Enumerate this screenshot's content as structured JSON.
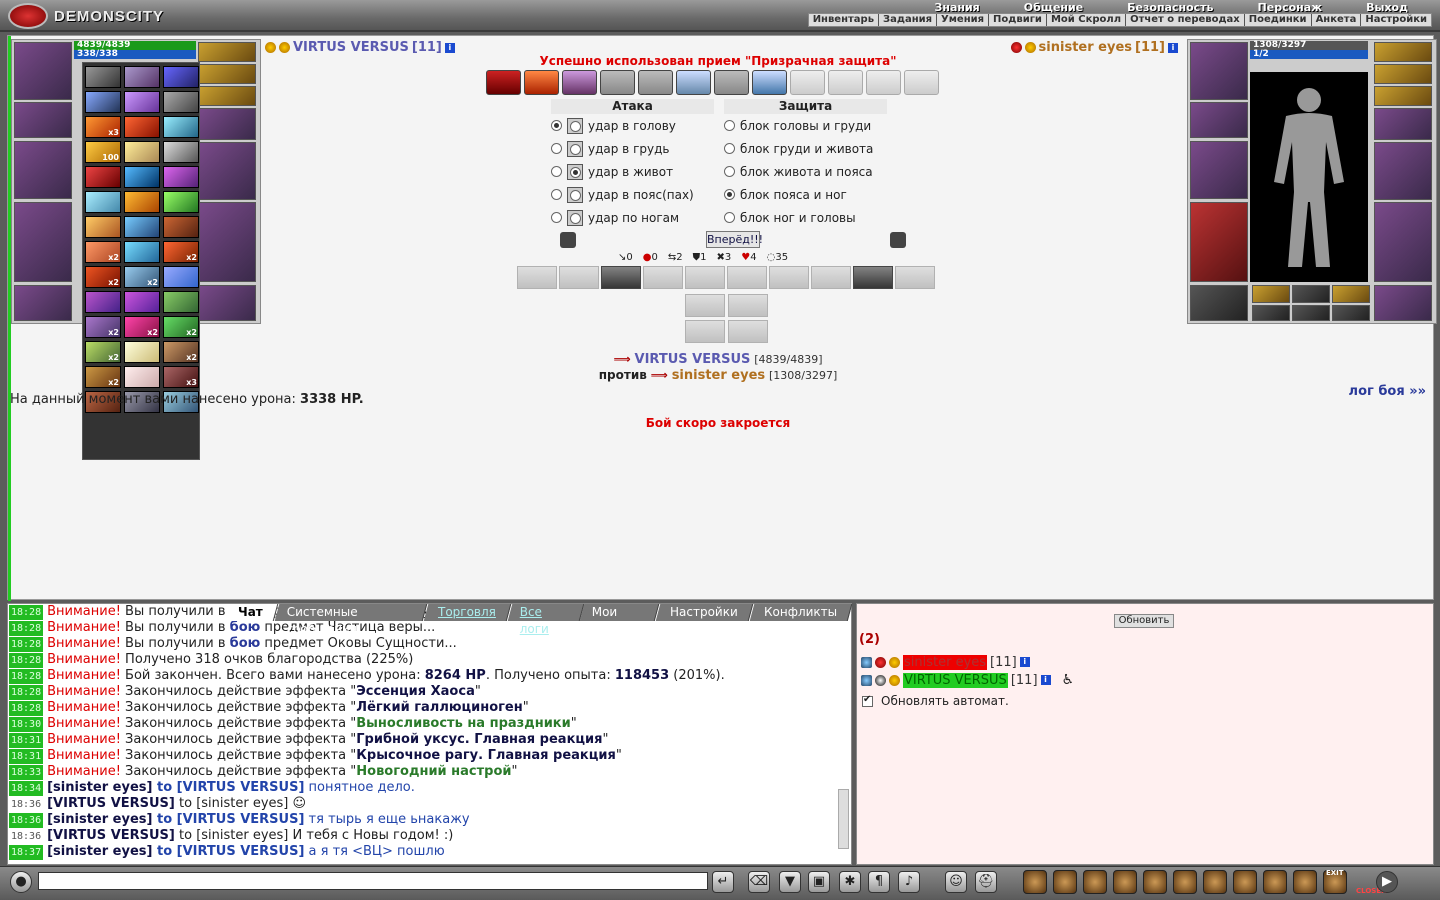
{
  "brand": {
    "name": "DEMONSCITY"
  },
  "nav": {
    "main": [
      "Знания",
      "Общение",
      "Безопасность",
      "Персонаж",
      "Выход"
    ],
    "sub": [
      "Инвентарь",
      "Задания",
      "Умения",
      "Подвиги",
      "Мой Скролл",
      "Отчет о переводах",
      "Поединки",
      "Анкета",
      "Настройки"
    ]
  },
  "player1": {
    "name": "VIRTUS VERSUS",
    "level": "[11]",
    "hp": "4839/4839",
    "mana": "338/338",
    "hp_full": "[4839/4839]"
  },
  "player2": {
    "name": "sinister eyes",
    "level": "[11]",
    "hp": "1308/3297",
    "mana": "1/2",
    "hp_full": "[1308/3297]"
  },
  "battle": {
    "status": "Успешно использован прием \"Призрачная защита\"",
    "attack_header": "Атака",
    "defense_header": "Защита",
    "attack_options": [
      "удар в голову",
      "удар в грудь",
      "удар в живот",
      "удар в пояс(пах)",
      "удар по ногам"
    ],
    "defense_options": [
      "блок головы и груди",
      "блок груди и живота",
      "блок живота и пояса",
      "блок пояса и ног",
      "блок ног и головы"
    ],
    "go_label": "Вперёд!!!",
    "counters": [
      "0",
      "0",
      "2",
      "1",
      "3",
      "4",
      "35"
    ],
    "versus_word": "против",
    "damage_prefix": "На данный момент вами нанесено урона:",
    "damage_value": "3338 HP.",
    "log_link": "лог боя »»",
    "closing_note": "Бой скоро закроется",
    "effect_badges": [
      "x3",
      "100",
      "x2",
      "x2",
      "x2",
      "x2",
      "x2",
      "x2",
      "x2",
      "x2",
      "x2",
      "x2",
      "x3"
    ]
  },
  "chat": {
    "tabs": [
      "Чат",
      "Системные сообщения",
      "Торговля",
      "Все логи",
      "Мои логи",
      "Настройки",
      "Конфликты"
    ],
    "lines": [
      {
        "t": "18:28",
        "warn": "Внимание!",
        "pre": " Вы получили в ",
        "link": "бою",
        "post": " предмет Сущность безумия..."
      },
      {
        "t": "18:28",
        "warn": "Внимание!",
        "pre": " Вы получили в ",
        "link": "бою",
        "post": " предмет Частица веры..."
      },
      {
        "t": "18:28",
        "warn": "Внимание!",
        "pre": " Вы получили в ",
        "link": "бою",
        "post": " предмет Оковы Сущности..."
      },
      {
        "t": "18:28",
        "warn": "Внимание!",
        "pre": " Получено 318 очков благородства (225%)",
        "link": "",
        "post": ""
      },
      {
        "t": "18:28",
        "warn": "Внимание!",
        "pre": " Бой закончен. Всего вами нанесено урона: ",
        "bold": "8264 HP",
        "post": ". Получено опыта: ",
        "bold2": "118453",
        "post2": " (201%)."
      },
      {
        "t": "18:28",
        "warn": "Внимание!",
        "pre": " Закончилось действие эффекта \"",
        "bold": "Эссенция Хаоса",
        "post": "\""
      },
      {
        "t": "18:28",
        "warn": "Внимание!",
        "pre": " Закончилось действие эффекта \"",
        "bold": "Лёгкий галлюциноген",
        "post": "\""
      },
      {
        "t": "18:30",
        "warn": "Внимание!",
        "pre": " Закончилось действие эффекта \"",
        "green": "Выносливость на праздники",
        "post": "\""
      },
      {
        "t": "18:31",
        "warn": "Внимание!",
        "pre": " Закончилось действие эффекта \"",
        "bold": "Грибной уксус. Главная реакция",
        "post": "\""
      },
      {
        "t": "18:31",
        "warn": "Внимание!",
        "pre": " Закончилось действие эффекта \"",
        "bold": "Крысочное рагу. Главная реакция",
        "post": "\""
      },
      {
        "t": "18:33",
        "warn": "Внимание!",
        "pre": " Закончилось действие эффекта \"",
        "green": "Новогодний настрой",
        "post": "\""
      }
    ],
    "msgs": [
      {
        "t": "18:34",
        "plain": false,
        "from": "[sinister eyes]",
        "to": " to [VIRTUS VERSUS]",
        "text": " понятное дело."
      },
      {
        "t": "18:36",
        "plain": true,
        "from": "[VIRTUS VERSUS]",
        "to": " to [sinister eyes]",
        "text": " ☺"
      },
      {
        "t": "18:36",
        "plain": false,
        "from": "[sinister eyes]",
        "to": " to [VIRTUS VERSUS]",
        "text": " тя тырь я еще ьнакажу"
      },
      {
        "t": "18:36",
        "plain": true,
        "from": "[VIRTUS VERSUS]",
        "to": " to [sinister eyes]",
        "text": " И тебя с Новы годом! :)"
      },
      {
        "t": "18:37",
        "plain": false,
        "from": "[sinister eyes]",
        "to": " to [VIRTUS VERSUS]",
        "text": " а я тя <ВЦ> пошлю"
      }
    ]
  },
  "online": {
    "refresh_label": "Обновить",
    "count": "(2)",
    "users": [
      {
        "name": "sinister eyes",
        "level": "[11]"
      },
      {
        "name": "VIRTUS VERSUS",
        "level": "[11]"
      }
    ],
    "autorefresh_label": "Обновлять автомат."
  },
  "toolbar": {
    "input_value": "",
    "exit_label": "EXIT",
    "closer_label": "CLOSER"
  }
}
